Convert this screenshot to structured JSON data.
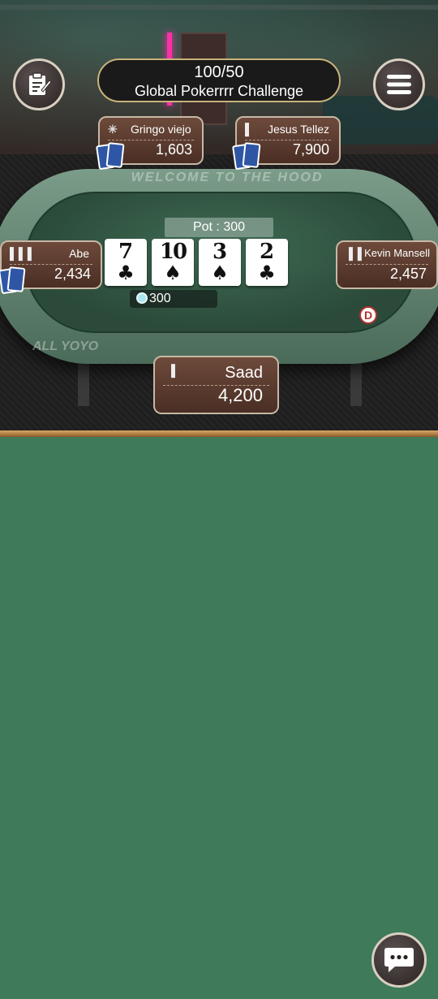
{
  "header": {
    "blinds": "100/50",
    "game_name": "Global Pokerrrr Challenge"
  },
  "icons": {
    "hand_history": "notepad-icon",
    "menu": "hamburger-menu-icon",
    "chat": "chat-icon"
  },
  "table": {
    "rail_text_top": "WELCOME TO THE HOOD",
    "rail_text_bottom": "ALL YOYO",
    "pot_label": "Pot : 300",
    "bet_amount": "300",
    "dealer_label": "D",
    "board": [
      {
        "rank": "7",
        "suit": "♣"
      },
      {
        "rank": "10",
        "suit": "♠"
      },
      {
        "rank": "3",
        "suit": "♠"
      },
      {
        "rank": "2",
        "suit": "♣"
      }
    ]
  },
  "players": {
    "gringo": {
      "name": "Gringo viejo",
      "chips": "1,603"
    },
    "jesus": {
      "name": "Jesus Tellez",
      "chips": "7,900"
    },
    "abe": {
      "name": "Abe",
      "chips": "2,434"
    },
    "kevin": {
      "name": "Kevin Mansell",
      "chips": "2,457"
    },
    "saad": {
      "name": "Saad",
      "chips": "4,200"
    }
  },
  "colors": {
    "felt": "#3f7a5a",
    "seat_border": "#c7b7a4",
    "title_border": "#c9b27a"
  }
}
